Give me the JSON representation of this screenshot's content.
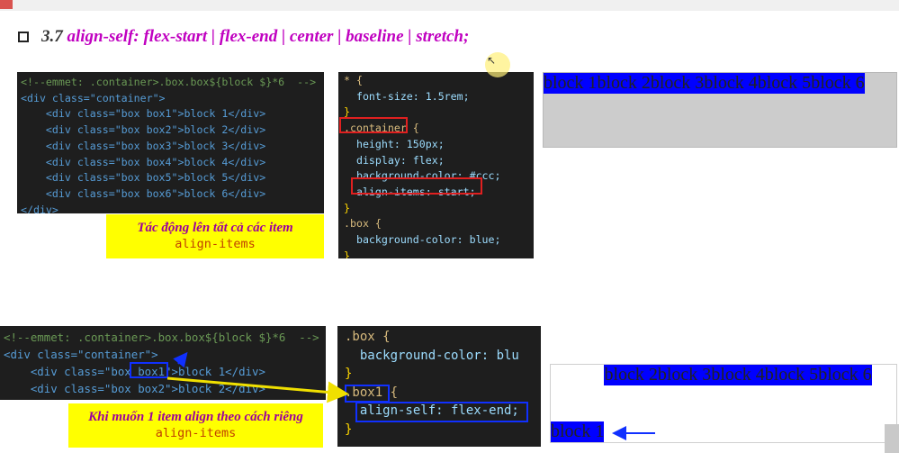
{
  "heading": {
    "number": "3.7",
    "text": "align-self:  flex-start | flex-end | center | baseline | stretch;"
  },
  "html_top": {
    "lines": [
      "<!--emmet: .container>.box.box${block $}*6  -->",
      "<div class=\"container\">",
      "    <div class=\"box box1\">block 1</div>",
      "    <div class=\"box box2\">block 2</div>",
      "    <div class=\"box box3\">block 3</div>",
      "    <div class=\"box box4\">block 4</div>",
      "    <div class=\"box box5\">block 5</div>",
      "    <div class=\"box box6\">block 6</div>",
      "</div>"
    ]
  },
  "css_top": {
    "lines": [
      "* {",
      "  font-size: 1.5rem;",
      "}",
      ".container {",
      "  height: 150px;",
      "  display: flex;",
      "  background-color: #ccc;",
      "  align-items: start;",
      "}",
      ".box {",
      "  background-color: blue;",
      "}"
    ]
  },
  "callout_top": {
    "text": "Tác động lên tất cả các item",
    "code": "align-items"
  },
  "html_bottom": {
    "lines": [
      "<!--emmet: .container>.box.box${block $}*6  -->",
      "<div class=\"container\">",
      "    <div class=\"box box1\">block 1</div>",
      "    <div class=\"box box2\">block 2</div>"
    ]
  },
  "css_bottom": {
    "lines": [
      ".box {",
      "  background-color: blu",
      "}",
      ".box1 {",
      "  align-self: flex-end;",
      "}"
    ]
  },
  "callout_bottom": {
    "text": "Khi muốn 1 item align theo cách riêng",
    "code": "align-items"
  },
  "demo_top": {
    "blocks": [
      "block 1",
      "block 2",
      "block 3",
      "block 4",
      "block 5",
      "block 6"
    ]
  },
  "demo_bottom": {
    "blocks": [
      "block 1",
      "block 2",
      "block 3",
      "block 4",
      "block 5",
      "block 6"
    ]
  },
  "colors": {
    "heading": "#c000c0",
    "callout_bg": "#ffff00",
    "callout_text": "#9c009c",
    "box_bg": "#0000ff",
    "container_bg": "#cccccc",
    "highlight_red": "#e02020",
    "highlight_blue": "#1030ff",
    "arrow_yellow": "#f0e000"
  },
  "icons": {
    "heading_bullet": "checkbox-square-icon",
    "cursor": "mouse-pointer-icon"
  }
}
